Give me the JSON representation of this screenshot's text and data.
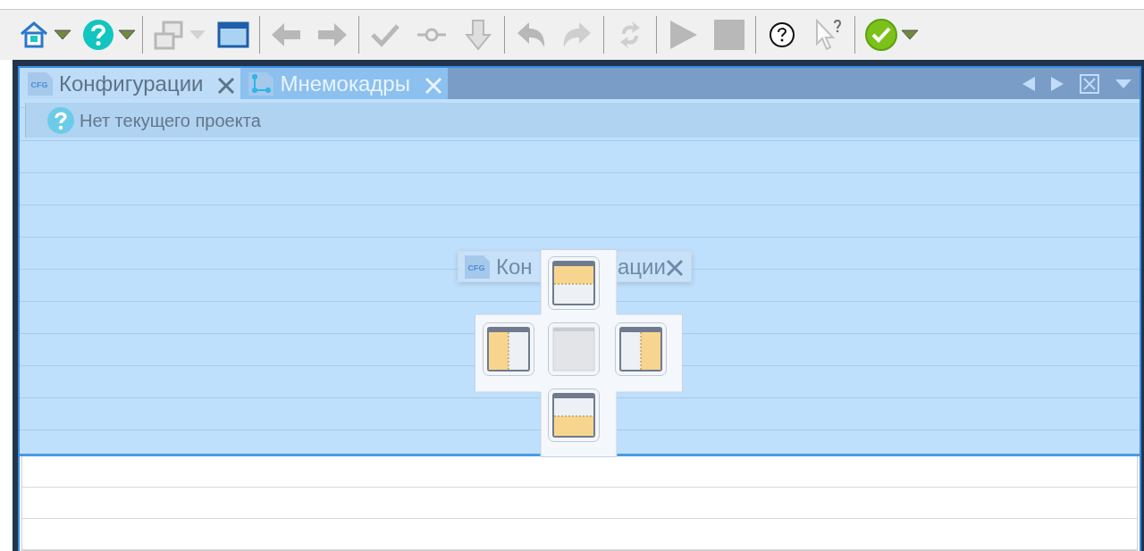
{
  "toolbar": [
    {
      "kind": "button",
      "disabled": false
    },
    {
      "kind": "dropdown",
      "disabled": false
    },
    {
      "kind": "button",
      "disabled": false
    },
    {
      "kind": "dropdown",
      "disabled": false
    },
    {
      "kind": "separator"
    },
    {
      "kind": "button",
      "disabled": true
    },
    {
      "kind": "dropdown",
      "disabled": true
    },
    {
      "kind": "button",
      "disabled": false
    },
    {
      "kind": "separator"
    },
    {
      "kind": "button",
      "disabled": true
    },
    {
      "kind": "button",
      "disabled": true
    },
    {
      "kind": "separator"
    },
    {
      "kind": "button",
      "disabled": true
    },
    {
      "kind": "button",
      "disabled": true
    },
    {
      "kind": "button",
      "disabled": true
    },
    {
      "kind": "separator"
    },
    {
      "kind": "button",
      "disabled": true
    },
    {
      "kind": "button",
      "disabled": true
    },
    {
      "kind": "separator"
    },
    {
      "kind": "button",
      "disabled": true
    },
    {
      "kind": "separator"
    },
    {
      "kind": "button",
      "disabled": true
    },
    {
      "kind": "button",
      "disabled": true
    },
    {
      "kind": "separator"
    },
    {
      "kind": "button",
      "disabled": false
    },
    {
      "kind": "button",
      "disabled": true
    },
    {
      "kind": "separator"
    },
    {
      "kind": "button",
      "disabled": false
    },
    {
      "kind": "dropdown",
      "disabled": false
    }
  ],
  "tabs": [
    {
      "label": "Конфигурации",
      "icon_text": "CFG",
      "selected": true
    },
    {
      "label": "Мнемокадры",
      "selected": false
    }
  ],
  "panel": {
    "message": "Нет текущего проекта"
  },
  "drag_preview": {
    "icon_text": "CFG",
    "text_parts": [
      "Кон",
      "ации"
    ]
  }
}
